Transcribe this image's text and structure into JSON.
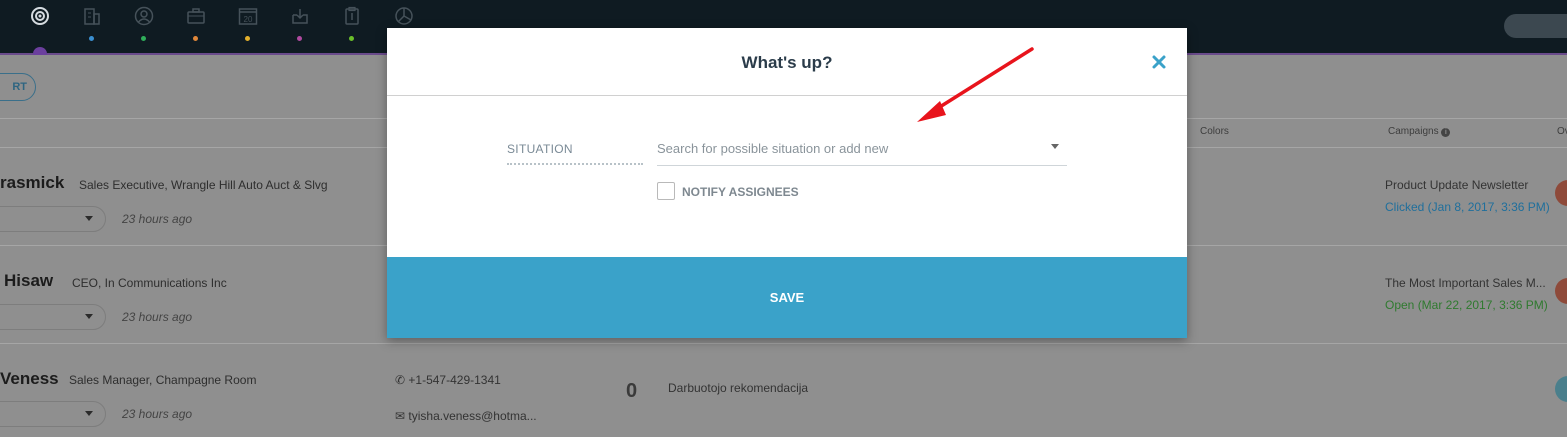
{
  "topbar": {
    "nav_items": [
      {
        "icon": "target-icon",
        "dot_color": ""
      },
      {
        "icon": "building-icon",
        "dot_color": "#3b8fd0"
      },
      {
        "icon": "person-icon",
        "dot_color": "#2fae5a"
      },
      {
        "icon": "briefcase-icon",
        "dot_color": "#e0873a"
      },
      {
        "icon": "calendar-icon",
        "calendar_day": "20",
        "dot_color": "#e3b02c"
      },
      {
        "icon": "inbox-icon",
        "dot_color": "#b04aa0"
      },
      {
        "icon": "clipboard-icon",
        "dot_color": "#6bbf2a"
      },
      {
        "icon": "chart-pie-icon",
        "dot_color": ""
      }
    ],
    "accent_color": "#6b3f9e"
  },
  "background": {
    "start_button": "RT",
    "columns": {
      "colors": "Colors",
      "campaigns": "Campaigns",
      "owner": "Ov"
    },
    "rows": [
      {
        "name": "rasmick",
        "title": "Sales Executive, Wrangle Hill Auto Auct & Slvg",
        "time": "23 hours ago",
        "campaign": "Product Update Newsletter",
        "campaign_status": "Clicked (Jan 8, 2017, 3:36 PM)",
        "status_color": "#1f6f9c"
      },
      {
        "name": "Hisaw",
        "title": "CEO, In Communications Inc",
        "time": "23 hours ago",
        "campaign": "The Most Important Sales M...",
        "campaign_status": "Open (Mar 22, 2017, 3:36 PM)",
        "status_color": "#2f7a2f"
      },
      {
        "name": "Veness",
        "title": "Sales Manager, Champagne Room",
        "time": "23 hours ago",
        "phone": "+1-547-429-1341",
        "email": "tyisha.veness@hotma...",
        "count": "0",
        "source": "Darbuotojo rekomendacija"
      }
    ]
  },
  "modal": {
    "title": "What's up?",
    "situation_label": "SITUATION",
    "situation_placeholder": "Search for possible situation or add new",
    "notify_label": "NOTIFY ASSIGNEES",
    "save_label": "SAVE",
    "save_color": "#3aa2c9",
    "close_color": "#3aa2c9"
  },
  "annotation": {
    "arrow_color": "#e8141c"
  }
}
